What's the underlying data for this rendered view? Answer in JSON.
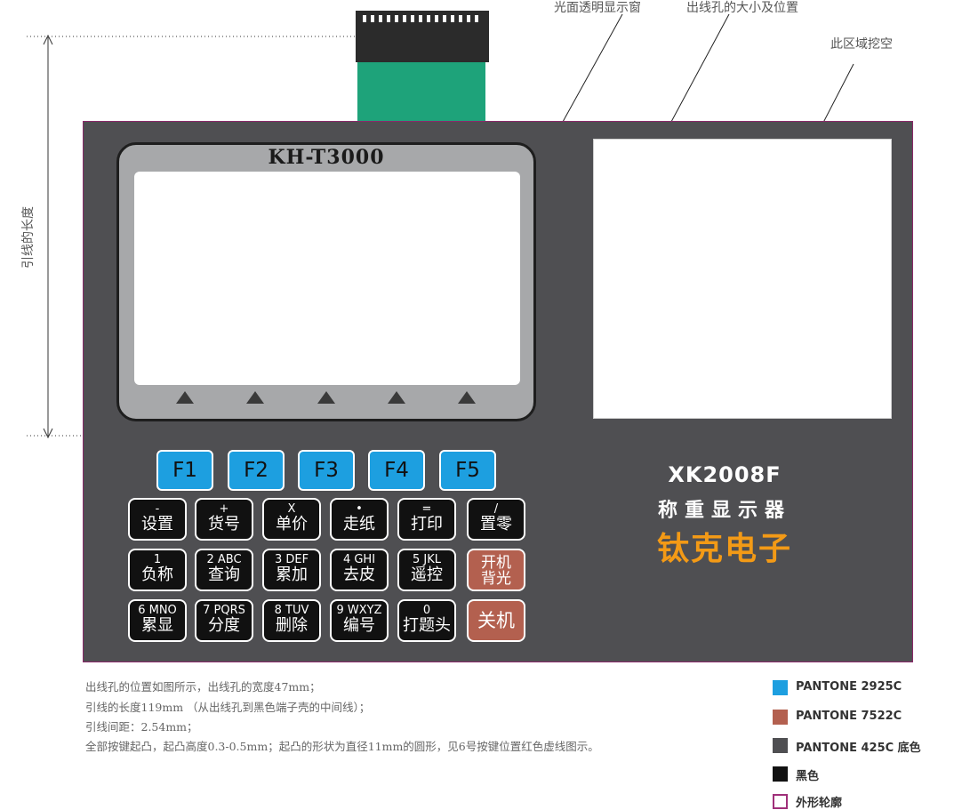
{
  "annotations": {
    "window_label": "光面透明显示窗",
    "hole_label": "出线孔的大小及位置",
    "cutout_label": "此区域挖空",
    "lead_length_label": "引线的长度"
  },
  "lcd": {
    "title": "KH-T3000"
  },
  "function_keys": [
    "F1",
    "F2",
    "F3",
    "F4",
    "F5"
  ],
  "keypad": [
    [
      {
        "top": "-",
        "bottom": "设置"
      },
      {
        "top": "+",
        "bottom": "货号"
      },
      {
        "top": "X",
        "bottom": "单价"
      },
      {
        "top": "•",
        "bottom": "走纸"
      },
      {
        "top": "=",
        "bottom": "打印"
      },
      {
        "top": "/",
        "bottom": "置零"
      }
    ],
    [
      {
        "top": "1",
        "bottom": "负称"
      },
      {
        "top": "2 ABC",
        "bottom": "查询"
      },
      {
        "top": "3 DEF",
        "bottom": "累加"
      },
      {
        "top": "4 GHI",
        "bottom": "去皮"
      },
      {
        "top": "5 JKL",
        "bottom": "遥控"
      }
    ],
    [
      {
        "top": "6 MNO",
        "bottom": "累显"
      },
      {
        "top": "7 PQRS",
        "bottom": "分度"
      },
      {
        "top": "8 TUV",
        "bottom": "删除"
      },
      {
        "top": "9 WXYZ",
        "bottom": "编号"
      },
      {
        "top": "0",
        "bottom": "打题头"
      }
    ]
  ],
  "red_keys": {
    "power_on_line1": "开机",
    "power_on_line2": "背光",
    "power_off": "关机"
  },
  "branding": {
    "model": "XK2008F",
    "device_name": "称重显示器",
    "company": "钛克电子"
  },
  "notes": [
    "出线孔的位置如图所示，出线孔的宽度47mm；",
    "引线的长度119mm （从出线孔到黑色端子壳的中间线）；",
    "引线间距：2.54mm；",
    "全部按键起凸，起凸高度0.3-0.5mm；起凸的形状为直径11mm的圆形，见6号按键位置红色虚线图示。"
  ],
  "legend": [
    {
      "label": "PANTONE  2925C",
      "color": "#1d9fe0"
    },
    {
      "label": "PANTONE  7522C",
      "color": "#b3604f"
    },
    {
      "label": "PANTONE  425C  底色",
      "color": "#4f4f52"
    },
    {
      "label": "黑色",
      "color": "#111111"
    },
    {
      "label": "外形轮廓",
      "color": "#ffffff"
    }
  ]
}
